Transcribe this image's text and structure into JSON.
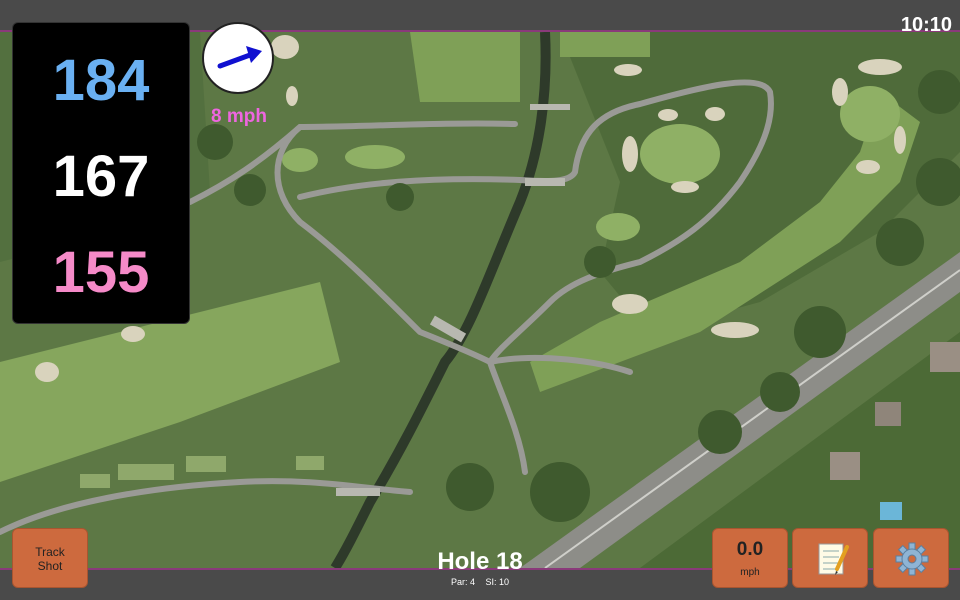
{
  "status_bar": {
    "time": "10:10"
  },
  "distances": {
    "back": "184",
    "middle": "167",
    "front": "155"
  },
  "wind": {
    "speed_label": "8 mph",
    "direction_icon": "arrow-icon"
  },
  "hole": {
    "title": "Hole 18",
    "par": "Par: 4",
    "stroke_index": "SI: 10"
  },
  "buttons": {
    "track_shot_line1": "Track",
    "track_shot_line2": "Shot",
    "speed_value": "0.0",
    "speed_unit": "mph",
    "notes_icon": "notepad-icon",
    "settings_icon": "gear-icon"
  },
  "colors": {
    "back_distance": "#6ab0f2",
    "middle_distance": "#ffffff",
    "front_distance": "#f58ac8",
    "wind_text": "#ee66e0",
    "button_bg": "#cd6a3e"
  }
}
